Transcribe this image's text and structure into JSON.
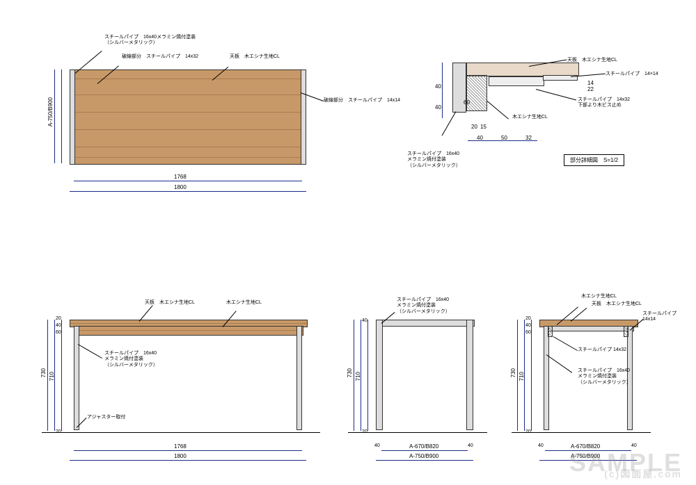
{
  "watermark": {
    "main": "SAMPLE",
    "sub": "(c)図面屋.com"
  },
  "detail_title": "部分詳細図　S=1/2",
  "top_view": {
    "callouts": {
      "c1": {
        "l1": "スチールパイプ　16x40メラミン焼付塗装",
        "l2": "（シルバーメタリック）"
      },
      "c2": "破線部分　スチールパイプ　14x32",
      "c3": "天板　木エシナ生地CL",
      "c4": "破線部分　スチールパイプ　14x14"
    },
    "dims": {
      "w_inner": "1768",
      "w_outer": "1800",
      "h": "A‐750/B900"
    }
  },
  "detail": {
    "callouts": {
      "c1": "天板　木エシナ生地CL",
      "c2": "スチールパイプ　14×14",
      "c3": {
        "l1": "スチールパイプ　14x32",
        "l2": "下部より木ビス止め"
      },
      "c4": "木エシナ生地CL",
      "c5": {
        "l1": "スチールパイプ　16x40",
        "l2": "メラミン焼付塗装",
        "l3": "（シルバーメタリック）"
      }
    },
    "dims": {
      "d40a": "40",
      "d40b": "40",
      "d20": "20",
      "d15": "15",
      "d50": "50",
      "d32": "32",
      "d60": "60",
      "d14": "14",
      "d22": "22"
    }
  },
  "front": {
    "callouts": {
      "c1": "天板　木エシナ生地CL",
      "c2": "木エシナ生地CL",
      "c3": {
        "l1": "スチールパイプ　16x40",
        "l2": "メラミン焼付塗装",
        "l3": "（シルバーメタリック）"
      },
      "c4": "アジャスター取付"
    },
    "dims": {
      "h_total": "730",
      "h_leg": "710",
      "h20": "20",
      "g20": "20",
      "d40": "40",
      "d60": "60",
      "w_inner": "1768",
      "w_outer": "1800"
    }
  },
  "side": {
    "callouts": {
      "c1": {
        "l1": "スチールパイプ　16x40",
        "l2": "メラミン焼付塗装",
        "l3": "（シルバーメタリック）"
      }
    },
    "dims": {
      "h_total": "730",
      "h_leg": "710",
      "h20": "20",
      "g20": "20",
      "d40a": "40",
      "d40b": "40",
      "w_inner": "A‐670/B820",
      "w_outer": "A‐750/B900"
    }
  },
  "section": {
    "callouts": {
      "c1": "木エシナ生地CL",
      "c2": "天板　木エシナ生地CL",
      "c3": {
        "l1": "スチールパイプ",
        "l2": "14x14"
      },
      "c4": "スチールパイプ 14x32",
      "c5": {
        "l1": "スチールパイプ　16x40",
        "l2": "メラミン焼付塗装",
        "l3": "（シルバーメタリック）"
      }
    },
    "dims": {
      "h_total": "730",
      "h_leg": "710",
      "h20": "20",
      "g20": "20",
      "d40": "40",
      "d60": "60",
      "d40r": "40",
      "w_inner": "A‐670/B820",
      "w_outer": "A‐750/B900"
    }
  }
}
